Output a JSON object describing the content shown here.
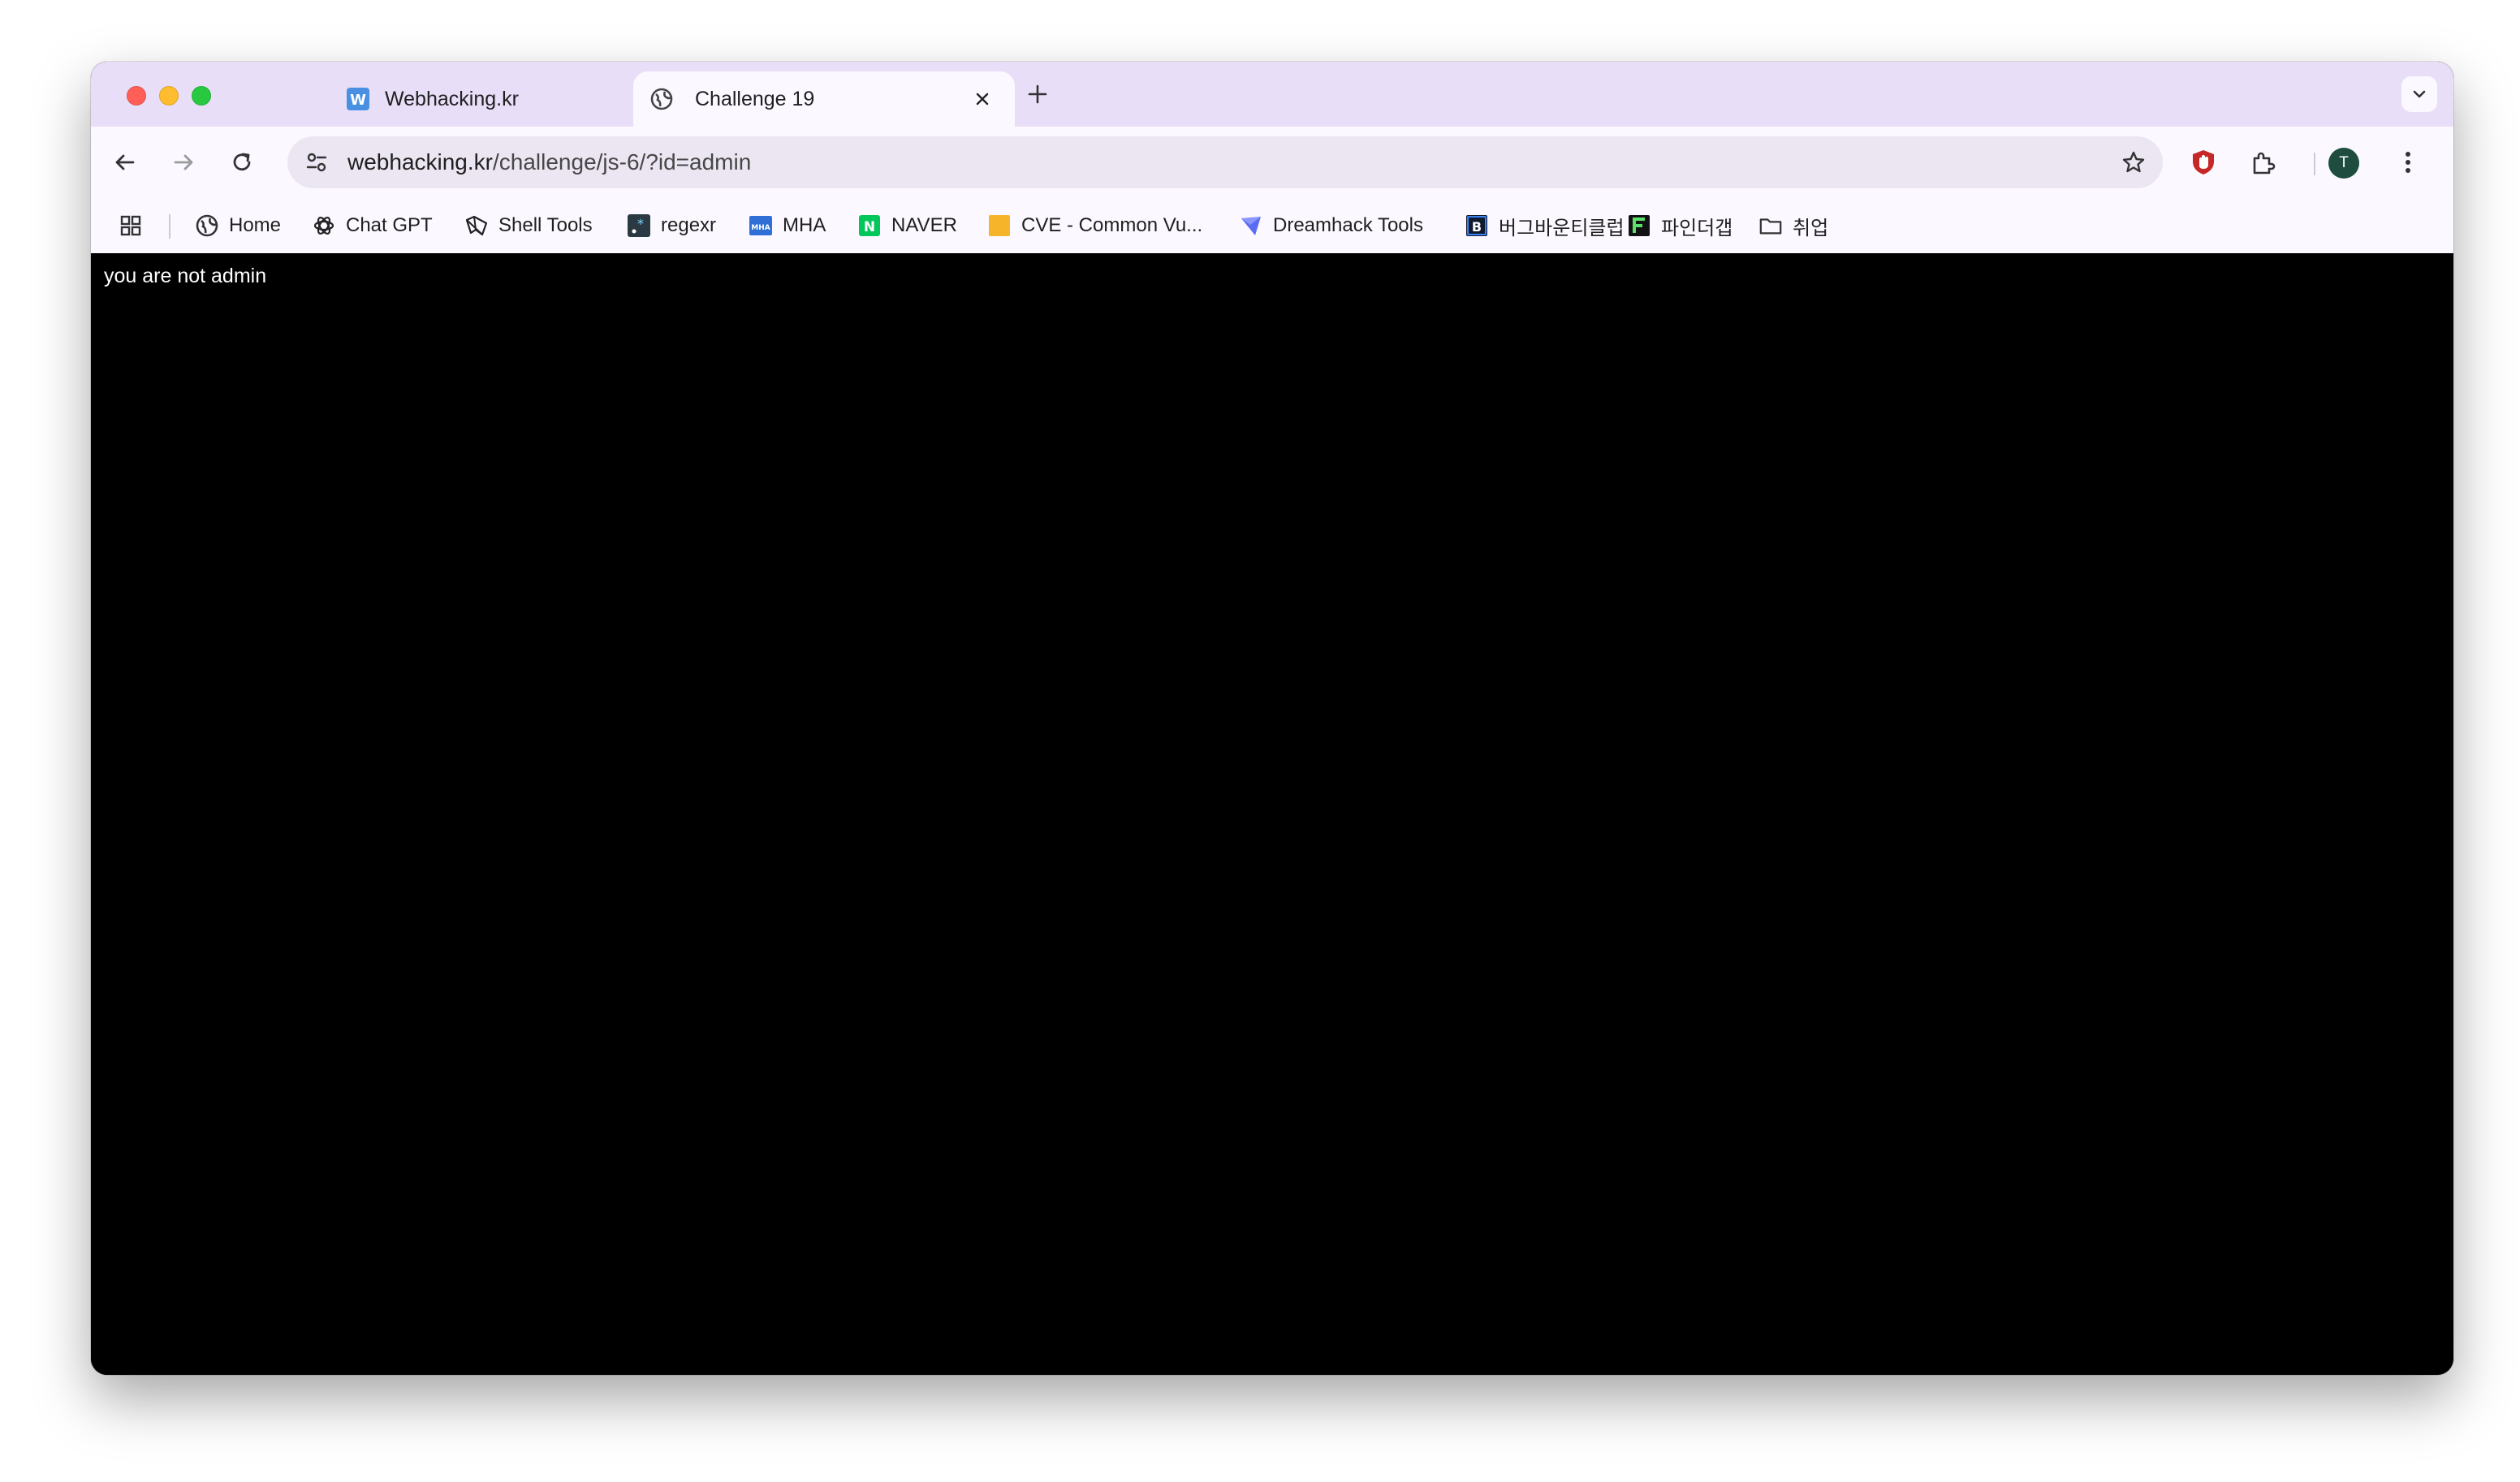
{
  "tabs": [
    {
      "title": "Webhacking.kr",
      "favicon": "w-logo-icon",
      "active": false
    },
    {
      "title": "Challenge 19",
      "favicon": "globe-icon",
      "active": true
    }
  ],
  "toolbar": {
    "url_host": "webhacking.kr",
    "url_path": "/challenge/js-6/?id=admin",
    "avatar_initial": "T"
  },
  "bookmarks": [
    {
      "label": "Home",
      "icon": "globe-icon"
    },
    {
      "label": "Chat GPT",
      "icon": "openai-icon"
    },
    {
      "label": "Shell Tools",
      "icon": "shell-tools-icon"
    },
    {
      "label": "regexr",
      "icon": "regexr-icon"
    },
    {
      "label": "MHA",
      "icon": "mha-icon"
    },
    {
      "label": "NAVER",
      "icon": "naver-icon"
    },
    {
      "label": "CVE - Common Vu...",
      "icon": "cve-icon"
    },
    {
      "label": "Dreamhack Tools",
      "icon": "dreamhack-icon"
    },
    {
      "label": "버그바운티클럽",
      "icon": "bugbounty-icon"
    },
    {
      "label": "파인더갭",
      "icon": "findthegap-icon"
    },
    {
      "label": "취업",
      "icon": "folder-icon"
    }
  ],
  "content": {
    "message": "you are not admin"
  },
  "colors": {
    "tabstrip": "#e8def8",
    "toolbar": "#fbf8ff",
    "omnibox": "#ece6f3",
    "page_bg": "#000000",
    "page_text": "#ffffff"
  }
}
